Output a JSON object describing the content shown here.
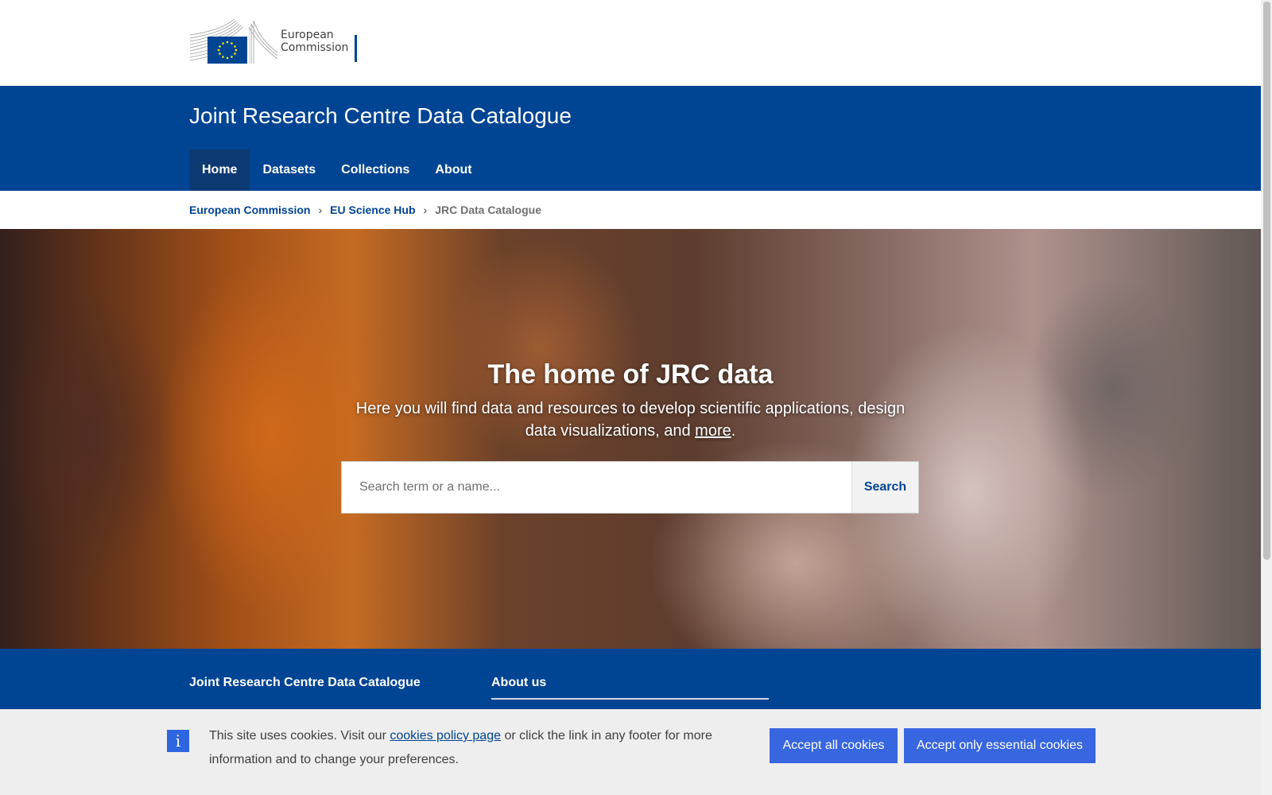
{
  "header": {
    "logo_text_line1": "European",
    "logo_text_line2": "Commission",
    "logo_icon": "eu-flag-icon",
    "site_name": "Joint Research Centre Data Catalogue",
    "brand_color": "#004494"
  },
  "nav": {
    "items": [
      {
        "label": "Home",
        "active": true
      },
      {
        "label": "Datasets",
        "active": false
      },
      {
        "label": "Collections",
        "active": false
      },
      {
        "label": "About",
        "active": false
      }
    ]
  },
  "breadcrumb": {
    "items": [
      "European Commission",
      "EU Science Hub"
    ],
    "current": "JRC Data Catalogue",
    "separator_icon": "chevron-right-icon"
  },
  "hero": {
    "title": "The home of JRC data",
    "text_before": "Here you will find data and resources to develop scientific applications, design data visualizations, and ",
    "link": "more",
    "text_after": ".",
    "search_placeholder": "Search term or a name...",
    "search_value": "",
    "search_button": "Search"
  },
  "footer": {
    "title": "Joint Research Centre Data Catalogue",
    "about_heading": "About us"
  },
  "cookie_banner": {
    "icon": "info-icon",
    "text_before": "This site uses cookies. Visit our ",
    "link": "cookies policy page",
    "text_after": " or click the link in any footer for more information and to change your preferences.",
    "accept_all": "Accept all cookies",
    "accept_essential": "Accept only essential cookies",
    "button_color": "#3866e0"
  }
}
